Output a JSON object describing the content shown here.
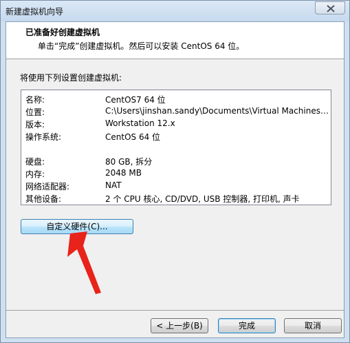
{
  "window": {
    "title": "新建虚拟机向导"
  },
  "header": {
    "title": "已准备好创建虚拟机",
    "subtitle": "单击“完成”创建虚拟机。然后可以安装 CentOS 64 位。"
  },
  "section_label": "将使用下列设置创建虚拟机:",
  "settings": [
    {
      "label": "名称:",
      "value": "CentOS7 64 位"
    },
    {
      "label": "位置:",
      "value": "C:\\Users\\jinshan.sandy\\Documents\\Virtual Machines\\CentO..."
    },
    {
      "label": "版本:",
      "value": "Workstation 12.x"
    },
    {
      "label": "操作系统:",
      "value": "CentOS 64 位"
    },
    {
      "label": "硬盘:",
      "value": "80 GB, 拆分"
    },
    {
      "label": "内存:",
      "value": "2048 MB"
    },
    {
      "label": "网络适配器:",
      "value": "NAT"
    },
    {
      "label": "其他设备:",
      "value": "2 个 CPU 核心, CD/DVD, USB 控制器, 打印机, 声卡"
    }
  ],
  "buttons": {
    "customize": "自定义硬件(C)...",
    "back": "< 上一步(B)",
    "finish": "完成",
    "cancel": "取消"
  },
  "icons": {
    "close": "close-icon",
    "annotation": "arrow-annotation"
  },
  "colors": {
    "arrow": "#e8231b",
    "accent_button_border": "#3c7fb1"
  }
}
